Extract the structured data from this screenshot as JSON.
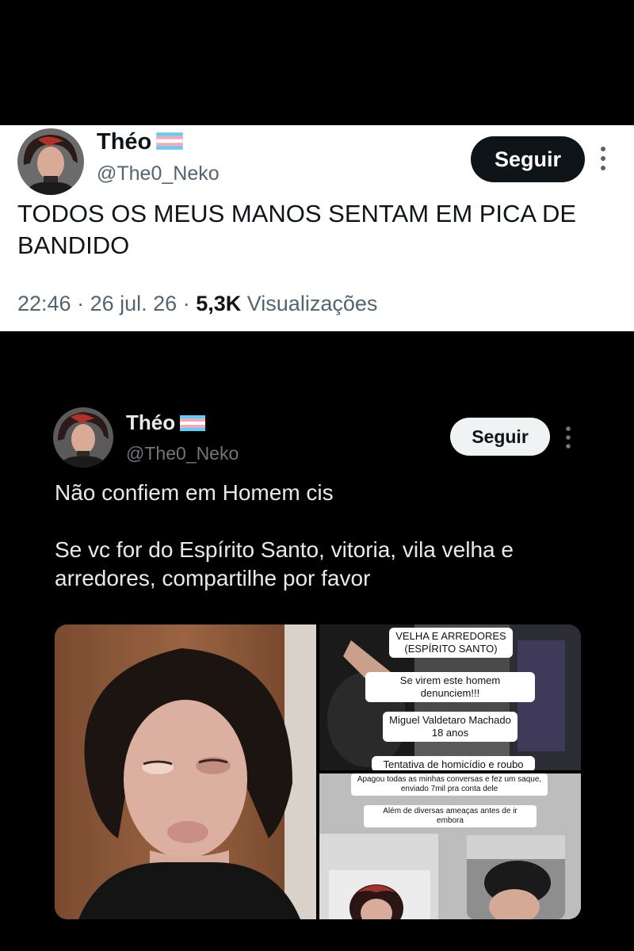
{
  "tweet1": {
    "name": "Théo",
    "handle": "@The0_Neko",
    "follow_label": "Seguir",
    "text": "TODOS OS MEUS MANOS SENTAM EM PICA DE BANDIDO",
    "time": "22:46",
    "date": "26 jul. 26",
    "views": "5,3K",
    "views_label": "Visualizações"
  },
  "tweet2": {
    "name": "Théo",
    "handle": "@The0_Neko",
    "follow_label": "Seguir",
    "paragraph1": "Não confiem em Homem cis",
    "paragraph2": "Se vc for do Espírito Santo, vitoria, vila velha e arredores, compartilhe por favor",
    "media": {
      "sticker_location": "VELHA E ARREDORES (ESPÍRITO SANTO)",
      "sticker_denounce": "Se virem este homem denunciem!!!",
      "sticker_name": "Miguel Valdetaro Machado",
      "sticker_age": "18 anos",
      "sticker_crime": "Tentativa de homicídio e roubo",
      "sticker_apagou": "Apagou todas as minhas conversas e fez um saque, enviado 7mil pra conta dele",
      "sticker_threats": "Além de diversas ameaças antes de ir embora"
    }
  },
  "colors": {
    "page_bg": "#000000",
    "card1_bg": "#ffffff",
    "text_dark": "#0f1419",
    "muted_light": "#536471",
    "text_light": "#e7e9ea",
    "muted_dark": "#71767b",
    "trans_blue": "#5BCEFA",
    "trans_pink": "#F5A9B8"
  },
  "icons": [
    "trans-flag-icon",
    "more-vertical-icon"
  ]
}
